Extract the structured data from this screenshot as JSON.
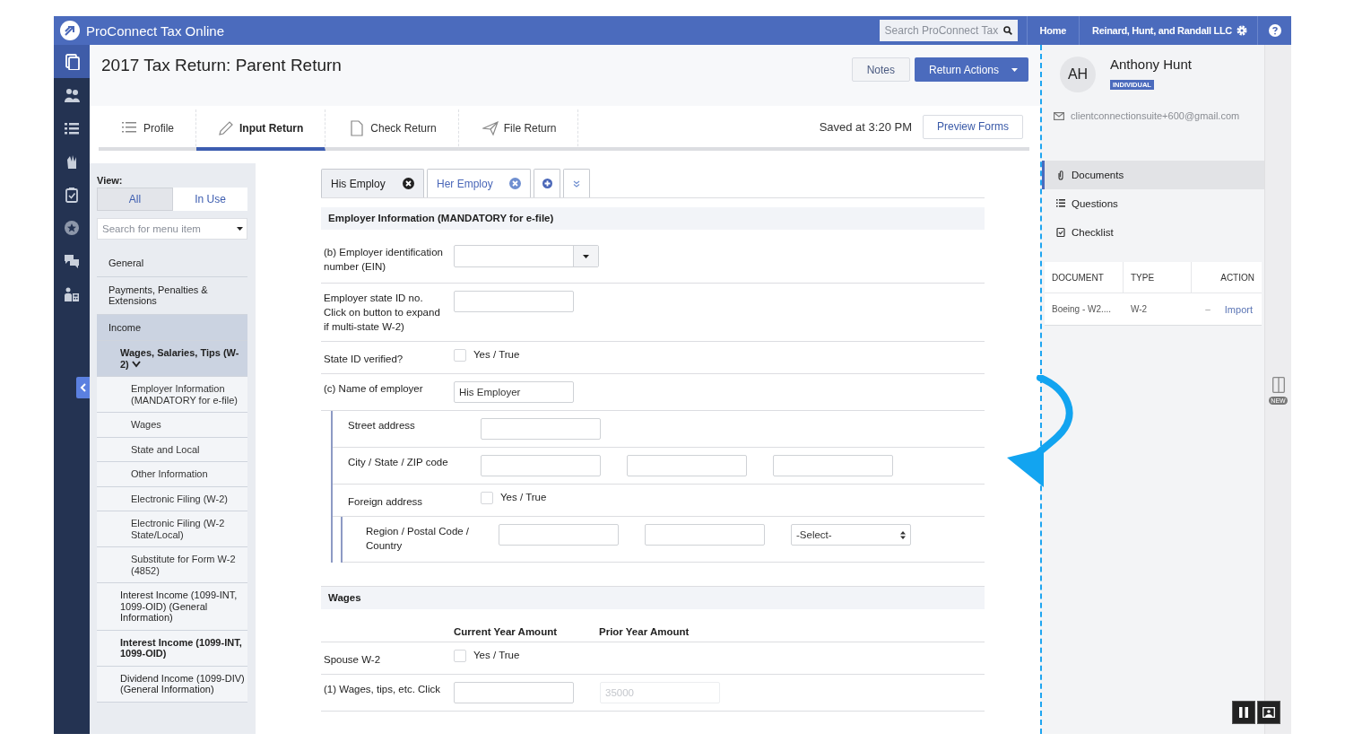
{
  "topbar": {
    "product": "ProConnect Tax Online",
    "search": {
      "placeholder": "Search ProConnect Tax"
    },
    "links": [
      "Home",
      "Reinard, Hunt, and Randall LLC"
    ]
  },
  "rail": {
    "items": [
      {
        "kind": "documents",
        "selected": true
      },
      {
        "kind": "clients",
        "selected": false
      },
      {
        "kind": "list",
        "selected": false
      },
      {
        "kind": "hand",
        "selected": false
      },
      {
        "kind": "clipboard",
        "selected": false
      },
      {
        "kind": "star",
        "selected": false
      },
      {
        "kind": "chat",
        "selected": false
      },
      {
        "kind": "calculator",
        "selected": false
      }
    ]
  },
  "header": {
    "title": "2017 Tax Return: Parent Return",
    "buttons": [
      {
        "label": "Notes",
        "kind": "secondary"
      },
      {
        "label": "Return Actions",
        "kind": "primary"
      }
    ]
  },
  "tabs": [
    {
      "label": "Profile",
      "kind": "profile",
      "selected": false
    },
    {
      "label": "Input Return",
      "kind": "input",
      "selected": true
    },
    {
      "label": "Check Return",
      "kind": "check",
      "selected": false
    },
    {
      "label": "File Return",
      "kind": "file",
      "selected": false
    }
  ],
  "saved": "Saved at 3:20 PM",
  "preview_button": "Preview Forms",
  "sidebar": {
    "view_label": "View:",
    "view_options": [
      {
        "label": "All",
        "selected": true
      },
      {
        "label": "In Use",
        "selected": false
      }
    ],
    "search": {
      "placeholder": "Search for menu item"
    },
    "items": [
      {
        "label": "General",
        "selected": false,
        "in_use": false
      },
      {
        "label": "Payments, Penalties & Extensions",
        "selected": false,
        "in_use": false
      },
      {
        "label": "Income",
        "selected": true,
        "in_use": false,
        "children": [
          {
            "label": "Wages, Salaries, Tips (W-2)",
            "selected": true,
            "in_use": true,
            "expanded": true,
            "children": [
              {
                "label": "Employer Information (MANDATORY for e-file)",
                "selected": false,
                "in_use": false
              },
              {
                "label": "Wages",
                "selected": false,
                "in_use": false
              },
              {
                "label": "State and Local",
                "selected": false,
                "in_use": false
              },
              {
                "label": "Other Information",
                "selected": false,
                "in_use": false
              },
              {
                "label": "Electronic Filing (W-2)",
                "selected": false,
                "in_use": false
              },
              {
                "label": "Electronic Filing (W-2 State/Local)",
                "selected": false,
                "in_use": false
              },
              {
                "label": "Substitute for Form W-2 (4852)",
                "selected": false,
                "in_use": false
              }
            ]
          },
          {
            "label": "Interest Income (1099-INT, 1099-OID) (General Information)",
            "selected": false,
            "in_use": false
          },
          {
            "label": "Interest Income (1099-INT, 1099-OID)",
            "selected": false,
            "in_use": true
          },
          {
            "label": "Dividend Income (1099-DIV) (General Information)",
            "selected": false,
            "in_use": false
          }
        ]
      }
    ]
  },
  "form": {
    "tabs": [
      {
        "label": "His Employ",
        "selected": true
      },
      {
        "label": "Her Employ",
        "selected": false
      }
    ],
    "sections": [
      {
        "title": "Employer Information (MANDATORY for e-file)",
        "rows": [
          {
            "kind": "combo",
            "label": "(b) Employer identification number (EIN)"
          },
          {
            "kind": "input",
            "label": "Employer state ID no. Click on button to expand if multi-state W-2)"
          },
          {
            "kind": "checkbox",
            "label": "State ID verified?",
            "option": "Yes / True",
            "checked": false
          },
          {
            "kind": "input",
            "label": "(c) Name of employer",
            "value": "His Employer"
          },
          {
            "kind": "group",
            "rows": [
              {
                "kind": "input",
                "label": "Street address"
              },
              {
                "kind": "inputs",
                "label": "City / State / ZIP code",
                "fields": [
                  {
                    "kind": "text"
                  },
                  {
                    "kind": "text"
                  },
                  {
                    "kind": "text"
                  }
                ]
              },
              {
                "kind": "checkbox",
                "label": "Foreign address",
                "option": "Yes / True",
                "checked": false
              },
              {
                "kind": "group",
                "rows": [
                  {
                    "kind": "inputs",
                    "label": "Region / Postal Code / Country",
                    "fields": [
                      {
                        "kind": "text"
                      },
                      {
                        "kind": "text"
                      },
                      {
                        "kind": "select",
                        "value": "-Select-"
                      }
                    ]
                  }
                ]
              }
            ]
          }
        ]
      },
      {
        "title": "Wages",
        "rows": [
          {
            "kind": "columns",
            "labels": [
              "Current Year Amount",
              "Prior Year Amount"
            ]
          },
          {
            "kind": "checkbox",
            "label": "Spouse W-2",
            "option": "Yes / True",
            "checked": false
          },
          {
            "kind": "inputs",
            "label": "(1) Wages, tips, etc. Click",
            "fields": [
              {
                "kind": "text"
              },
              {
                "kind": "text",
                "placeholder": "35000",
                "disabled": true
              }
            ]
          }
        ]
      }
    ]
  },
  "client": {
    "initials": "AH",
    "name": "Anthony Hunt",
    "badge": "INDIVIDUAL",
    "email": "clientconnectionsuite+600@gmail.com",
    "nav": [
      {
        "label": "Documents",
        "kind": "documents",
        "selected": true
      },
      {
        "label": "Questions",
        "kind": "questions",
        "selected": false
      },
      {
        "label": "Checklist",
        "kind": "checklist",
        "selected": false
      }
    ],
    "table": {
      "columns": [
        "DOCUMENT",
        "TYPE",
        "ACTION"
      ],
      "rows": [
        {
          "document": "Boeing - W2....",
          "type": "W-2",
          "status": "–",
          "action": "Import"
        }
      ]
    }
  },
  "side_strip": {
    "badge": "NEW"
  }
}
